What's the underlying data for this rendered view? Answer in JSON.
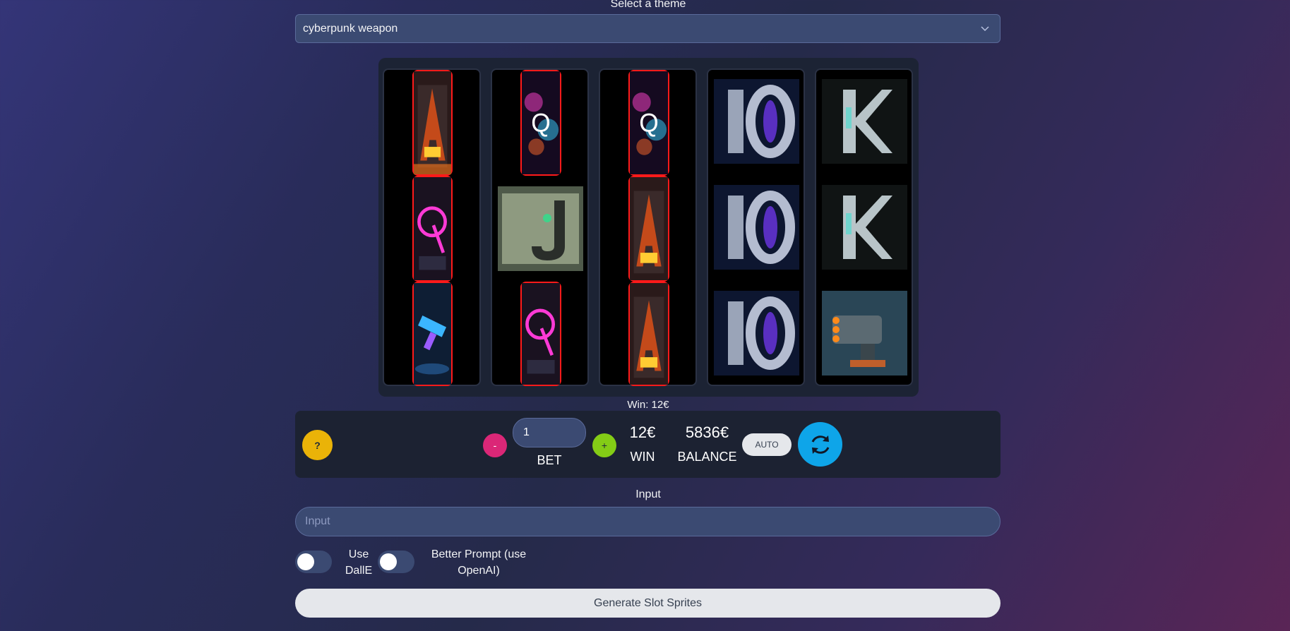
{
  "theme": {
    "label": "Select a theme",
    "selected": "cyberpunk weapon"
  },
  "reels": [
    [
      "A",
      "Q",
      "Gun"
    ],
    [
      "Q-fireworks",
      "J",
      "Q"
    ],
    [
      "Q-fireworks",
      "A",
      "A"
    ],
    [
      "10",
      "10",
      "10"
    ],
    [
      "K",
      "K",
      "Cannon"
    ]
  ],
  "winning_cells": {
    "reel_1": [
      1,
      2,
      3
    ],
    "reel_2": [
      1,
      3
    ],
    "reel_3": [
      1,
      2,
      3
    ]
  },
  "win_text": "Win: 12€",
  "controls": {
    "help": "?",
    "minus": "-",
    "plus": "+",
    "bet_value": "1",
    "bet_label": "BET",
    "win_value": "12€",
    "win_label": "WIN",
    "balance_value": "5836€",
    "balance_label": "BALANCE",
    "auto_label": "AUTO",
    "spin_icon": "refresh-icon"
  },
  "input": {
    "label": "Input",
    "placeholder": "Input"
  },
  "toggles": {
    "dalle_label_1": "Use",
    "dalle_label_2": "DallE",
    "better_prompt_label_1": "Better Prompt (use",
    "better_prompt_label_2": "OpenAI)"
  },
  "generate_label": "Generate Slot Sprites",
  "colors": {
    "highlight": "#ff1a1a",
    "help_btn": "#eab308",
    "minus_btn": "#db2777",
    "plus_btn": "#84cc16",
    "spin_btn": "#0ea5e9"
  }
}
